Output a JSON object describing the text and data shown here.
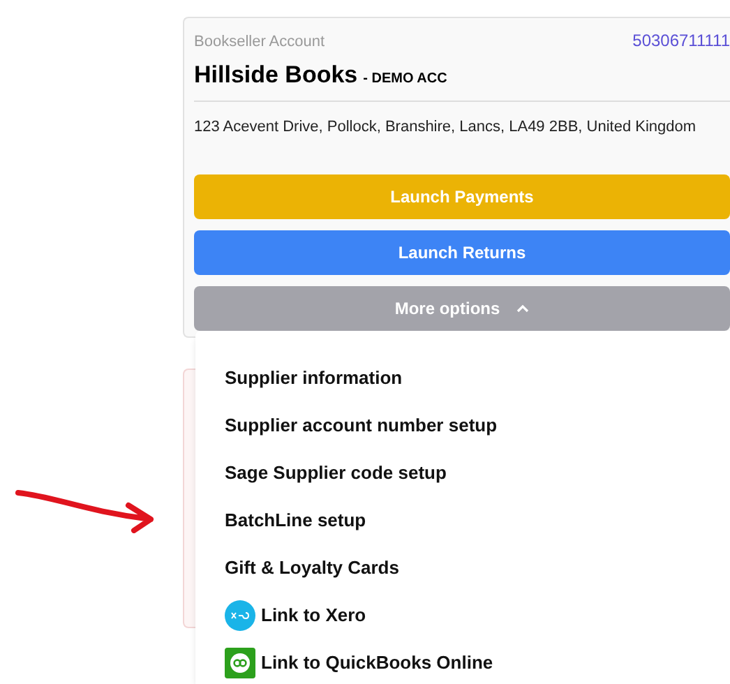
{
  "account": {
    "label": "Bookseller Account",
    "number": "50306711111",
    "name": "Hillside Books",
    "tag": "- DEMO ACC",
    "address": "123 Acevent Drive, Pollock, Branshire, Lancs, LA49 2BB, United Kingdom"
  },
  "buttons": [
    {
      "label": "Launch Payments",
      "kind": "payments"
    },
    {
      "label": "Launch Returns",
      "kind": "returns"
    },
    {
      "label": "More options",
      "kind": "more",
      "expanded": true
    }
  ],
  "menu": [
    {
      "label": "Supplier information",
      "kind": "plain"
    },
    {
      "label": "Supplier account number setup",
      "kind": "plain"
    },
    {
      "label": "Sage Supplier code setup",
      "kind": "plain"
    },
    {
      "label": "BatchLine setup",
      "kind": "plain"
    },
    {
      "label": "Gift & Loyalty Cards",
      "kind": "plain"
    },
    {
      "label": "Link to Xero",
      "kind": "xero"
    },
    {
      "label": "Link to QuickBooks Online",
      "kind": "quickbooks"
    }
  ]
}
